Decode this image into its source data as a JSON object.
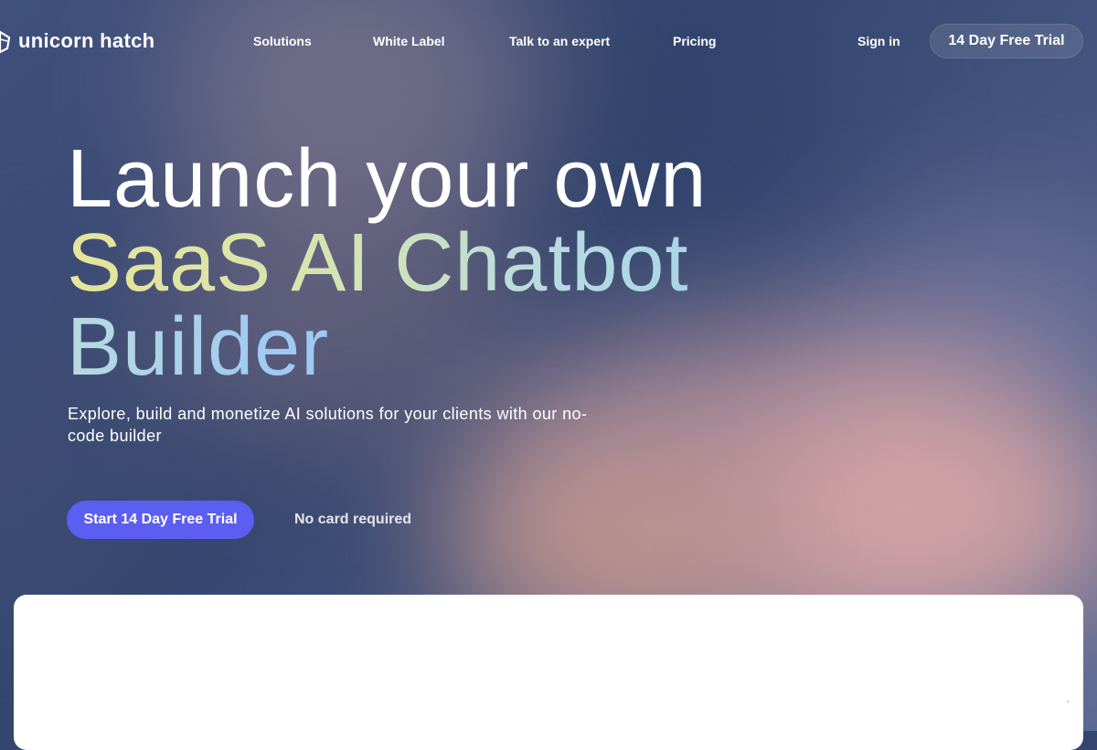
{
  "brand": {
    "name": "unicorn hatch",
    "icon": "unicorn-logo-icon"
  },
  "nav": {
    "items": [
      {
        "label": "Solutions"
      },
      {
        "label": "White Label"
      },
      {
        "label": "Talk to an expert"
      },
      {
        "label": "Pricing"
      }
    ],
    "sign_in": "Sign in",
    "trial_button": "14 Day Free Trial"
  },
  "hero": {
    "title_line1": "Launch your own",
    "title_line2": "SaaS AI Chatbot",
    "title_line3": "Builder",
    "subtitle": "Explore, build and monetize AI solutions for your clients with our no-code builder",
    "cta_label": "Start 14 Day Free Trial",
    "cta_note": "No card required",
    "colors": {
      "cta": "#5b5ef1",
      "gradient_start": "#e6e597",
      "gradient_end": "#9ec9f2"
    }
  }
}
